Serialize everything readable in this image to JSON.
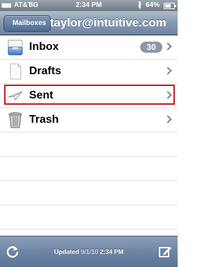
{
  "status": {
    "signal": "▮▮▮▮",
    "carrier": "AT&T",
    "network": "3G",
    "time": "2:34 PM",
    "bluetooth": "∦",
    "battery_text": "64%",
    "battery_level": 0.64
  },
  "nav": {
    "back_label": "Mailboxes",
    "title": "taylor@intuitive.com"
  },
  "mailboxes": [
    {
      "label": "Inbox",
      "badge": "30",
      "icon": "inbox-icon"
    },
    {
      "label": "Drafts",
      "icon": "drafts-icon"
    },
    {
      "label": "Sent",
      "icon": "sent-icon"
    },
    {
      "label": "Trash",
      "icon": "trash-icon"
    }
  ],
  "toolbar": {
    "updated_label": "Updated",
    "updated_date": "9/1/10",
    "updated_time": "2:34 PM"
  },
  "colors": {
    "selection_outline": "#c0191e",
    "badge": "#8c97a8"
  }
}
